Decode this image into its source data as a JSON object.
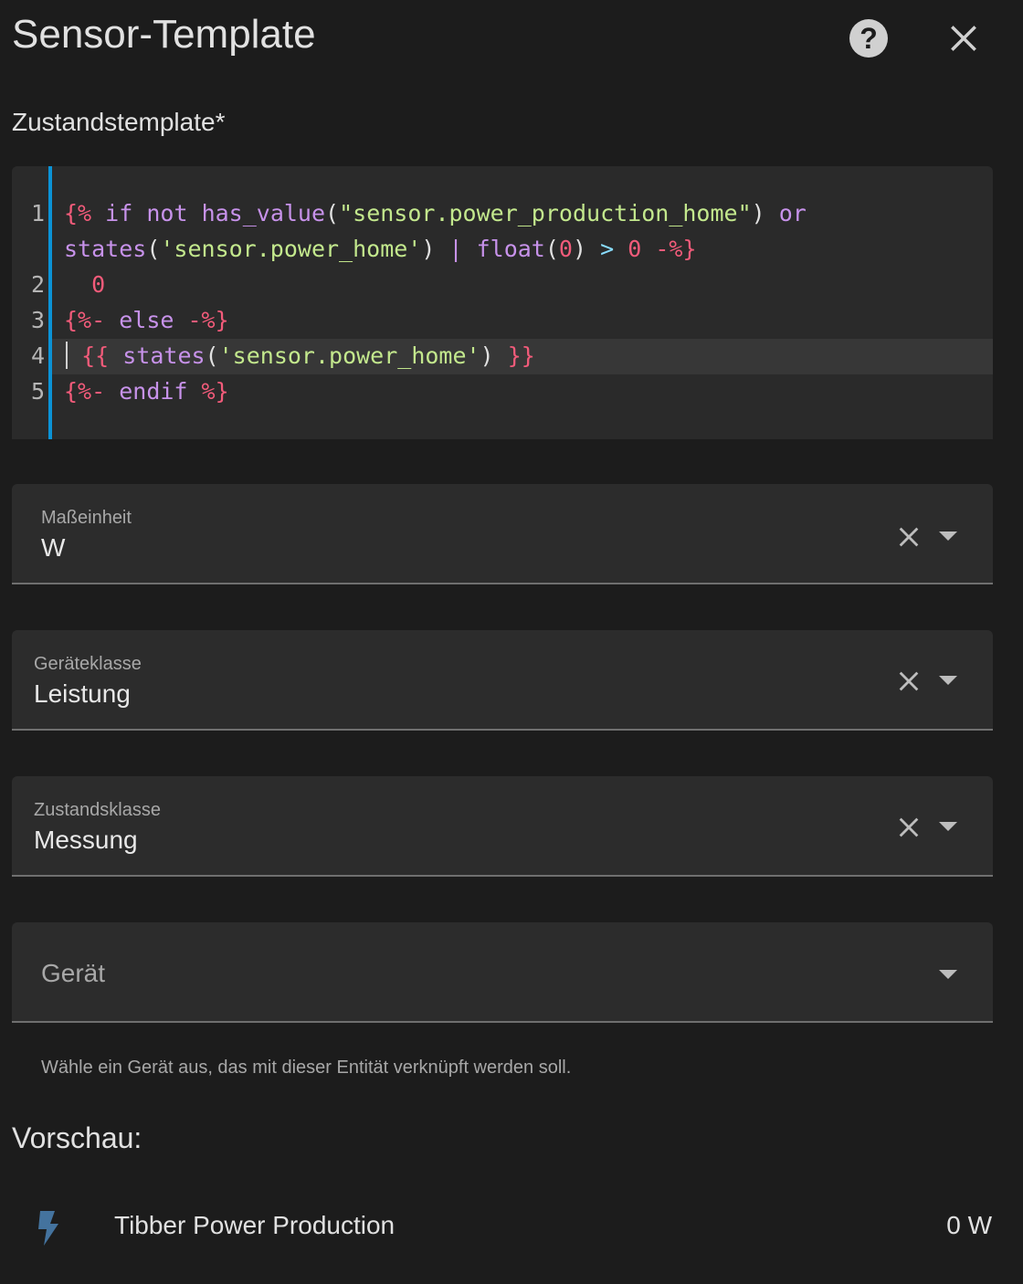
{
  "dialog": {
    "title": "Sensor-Template",
    "help_icon": "help-circle-icon",
    "close_icon": "close-icon"
  },
  "state_template": {
    "label": "Zustandstemplate*",
    "line_numbers": [
      "1",
      "2",
      "3",
      "4",
      "5"
    ],
    "code_lines": [
      "{% if not has_value(\"sensor.power_production_home\") or",
      "states('sensor.power_home') | float(0) > 0 -%}",
      "  0",
      "{%- else -%}",
      "  {{ states('sensor.power_home') }}",
      "{%- endif %}"
    ]
  },
  "unit_field": {
    "label": "Maßeinheit",
    "value": "W"
  },
  "device_class_field": {
    "label": "Geräteklasse",
    "value": "Leistung"
  },
  "state_class_field": {
    "label": "Zustandsklasse",
    "value": "Messung"
  },
  "device_field": {
    "placeholder": "Gerät",
    "helper": "Wähle ein Gerät aus, das mit dieser Entität verknüpft werden soll."
  },
  "preview": {
    "title": "Vorschau:",
    "icon": "flash-icon",
    "entity_name": "Tibber Power Production",
    "state": "0 W"
  },
  "colors": {
    "accent": "#0b93d6",
    "icon": "#44739e",
    "background": "#1c1c1c"
  }
}
